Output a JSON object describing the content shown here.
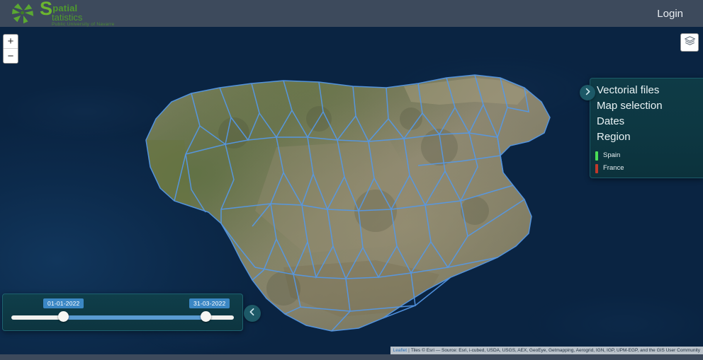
{
  "header": {
    "brand_letter": "S",
    "brand_word1": "patial",
    "brand_word2": "tatistics",
    "brand_subtitle": "Public University of Navarre",
    "login_label": "Login"
  },
  "map_controls": {
    "zoom_in_label": "+",
    "zoom_out_label": "−",
    "layers_icon": "layers-icon"
  },
  "right_panel": {
    "toggle_icon": "chevron-right-icon",
    "items": [
      {
        "label": "Vectorial files"
      },
      {
        "label": "Map selection"
      },
      {
        "label": "Dates"
      },
      {
        "label": "Region"
      }
    ],
    "legend": [
      {
        "label": "Spain",
        "color": "#4ade55"
      },
      {
        "label": "France",
        "color": "#c0392b"
      }
    ]
  },
  "date_slider": {
    "toggle_icon": "chevron-left-icon",
    "start_date": "01-01-2022",
    "end_date": "31-03-2022",
    "range_fill_color": "#5a9bd2",
    "label_color": "#3b87c4"
  },
  "attribution": {
    "leaflet": "Leaflet",
    "separator": "|",
    "text": "Tiles © Esri — Source: Esri, i-cubed, USDA, USGS, AEX, GeoEye, Getmapping, Aerogrid, IGN, IGP, UPM-EGP, and the GIS User Community"
  },
  "map": {
    "border_color": "#5599e8",
    "country": "Spain",
    "basemap": "satellite-imagery"
  }
}
